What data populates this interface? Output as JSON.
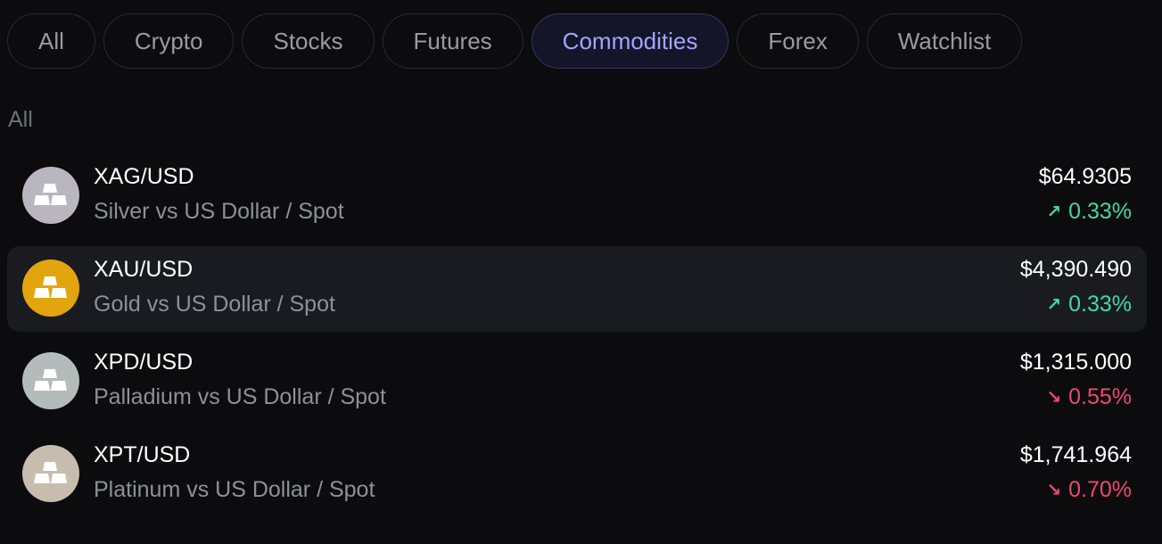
{
  "tabs": [
    {
      "label": "All"
    },
    {
      "label": "Crypto"
    },
    {
      "label": "Stocks"
    },
    {
      "label": "Futures"
    },
    {
      "label": "Commodities",
      "active": true
    },
    {
      "label": "Forex"
    },
    {
      "label": "Watchlist"
    }
  ],
  "section_label": "All",
  "assets": [
    {
      "symbol": "XAG/USD",
      "name": "Silver vs US Dollar / Spot",
      "price": "$64.9305",
      "change": "0.33%",
      "direction": "up",
      "icon": "silver-bars-icon",
      "icon_color": "#b9b6c0"
    },
    {
      "symbol": "XAU/USD",
      "name": "Gold vs US Dollar / Spot",
      "price": "$4,390.490",
      "change": "0.33%",
      "direction": "up",
      "icon": "gold-bars-icon",
      "icon_color": "#e3a50e"
    },
    {
      "symbol": "XPD/USD",
      "name": "Palladium vs US Dollar / Spot",
      "price": "$1,315.000",
      "change": "0.55%",
      "direction": "down",
      "icon": "palladium-bars-icon",
      "icon_color": "#b4bcbb"
    },
    {
      "symbol": "XPT/USD",
      "name": "Platinum vs US Dollar / Spot",
      "price": "$1,741.964",
      "change": "0.70%",
      "direction": "down",
      "icon": "platinum-bars-icon",
      "icon_color": "#c7bcae"
    }
  ],
  "colors": {
    "up": "#3fd9a0",
    "down": "#ef476f",
    "active_tab": "#a4a4ff"
  }
}
